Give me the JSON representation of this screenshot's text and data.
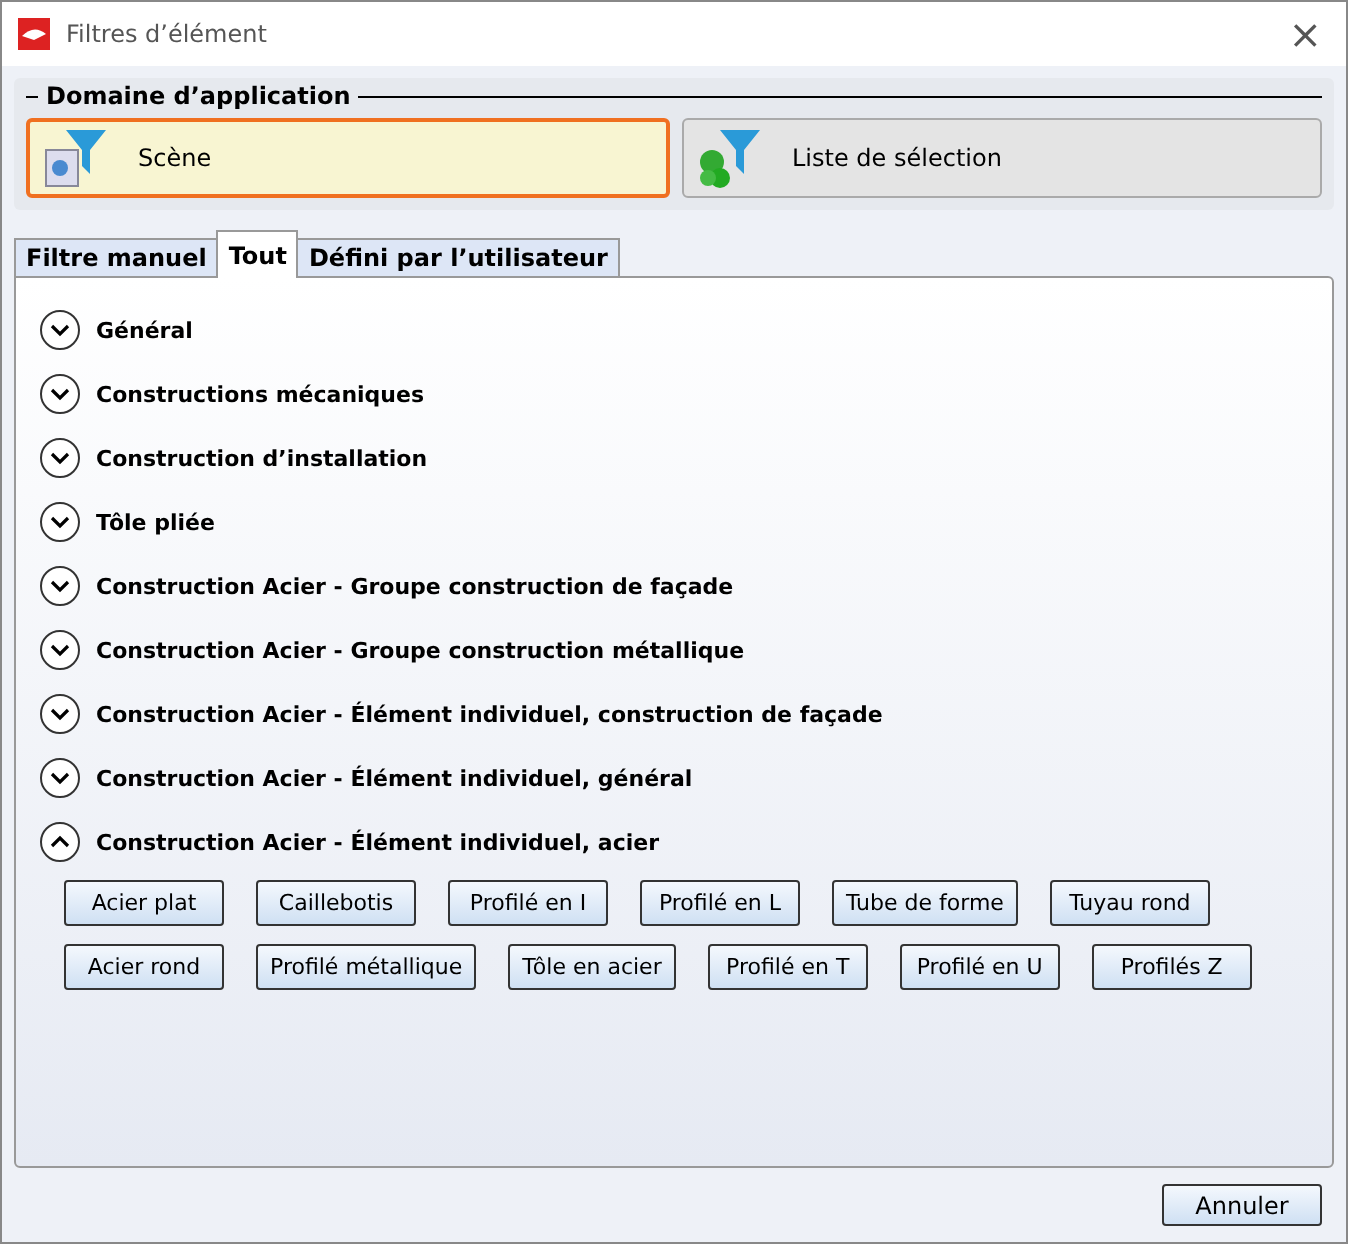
{
  "window": {
    "title": "Filtres d’élément",
    "close": "×"
  },
  "application_domain": {
    "title": "Domaine d’application",
    "options": [
      {
        "label": "Scène",
        "selected": true,
        "kind": "scene"
      },
      {
        "label": "Liste de sélection",
        "selected": false,
        "kind": "selection"
      }
    ]
  },
  "tabs": [
    {
      "label": "Filtre manuel",
      "selected": false
    },
    {
      "label": "Tout",
      "selected": true
    },
    {
      "label": "Défini par l’utilisateur",
      "selected": false
    }
  ],
  "sections": [
    {
      "title": "Général",
      "expanded": false
    },
    {
      "title": "Constructions mécaniques",
      "expanded": false
    },
    {
      "title": "Construction d’installation",
      "expanded": false
    },
    {
      "title": "Tôle pliée",
      "expanded": false
    },
    {
      "title": "Construction Acier - Groupe construction de façade",
      "expanded": false
    },
    {
      "title": "Construction Acier - Groupe construction métallique",
      "expanded": false
    },
    {
      "title": "Construction Acier - Élément individuel, construction de façade",
      "expanded": false
    },
    {
      "title": "Construction Acier - Élément individuel, général",
      "expanded": false
    },
    {
      "title": "Construction Acier - Élément individuel, acier",
      "expanded": true,
      "rows": [
        [
          "Acier plat",
          "Caillebotis",
          "Profilé en I",
          "Profilé en L",
          "Tube de forme",
          "Tuyau rond"
        ],
        [
          "Acier rond",
          "Profilé métallique",
          "Tôle en acier",
          "Profilé en T",
          "Profilé en U",
          "Profilés Z"
        ]
      ]
    }
  ],
  "buttons": [
    "Annuler"
  ]
}
